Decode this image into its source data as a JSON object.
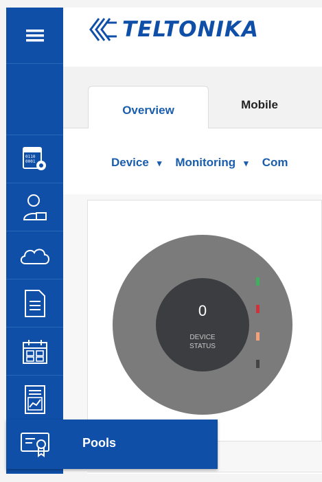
{
  "brand": {
    "name": "TELTONIKA",
    "color": "#0f4fa8"
  },
  "sidebar": {
    "menu_icon": "hamburger-icon",
    "items": [
      {
        "icon": "system-settings-icon"
      },
      {
        "icon": "admin-user-icon"
      },
      {
        "icon": "cloud-icon"
      },
      {
        "icon": "document-icon"
      },
      {
        "icon": "calendar-icon"
      },
      {
        "icon": "report-chart-icon"
      }
    ]
  },
  "tabs": [
    {
      "label": "Overview",
      "active": true
    },
    {
      "label": "Mobile",
      "active": false
    }
  ],
  "submenu": {
    "device": "Device",
    "monitoring": "Monitoring",
    "more": "Com",
    "caret": "▾"
  },
  "status": {
    "value": "0",
    "label_line1": "DEVICE",
    "label_line2": "STATUS"
  },
  "legend_colors": [
    "#3fae5e",
    "#d0313a",
    "#f4a07a",
    "#444444"
  ],
  "popover": {
    "label": "Pools",
    "icon": "certificate-icon"
  }
}
